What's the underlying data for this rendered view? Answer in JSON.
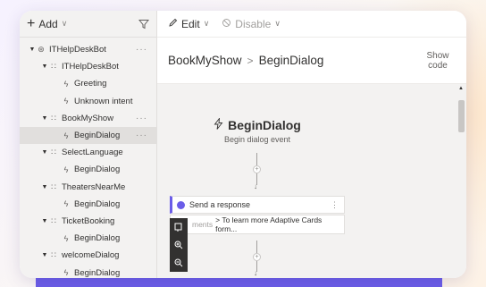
{
  "left_toolbar": {
    "add_label": "Add"
  },
  "tree": [
    {
      "label": "ITHelpDeskBot",
      "level": 0,
      "icon": "bot",
      "caret": true,
      "more": true,
      "selected": false
    },
    {
      "label": "ITHelpDeskBot",
      "level": 1,
      "icon": "dialog",
      "caret": true,
      "more": false,
      "selected": false
    },
    {
      "label": "Greeting",
      "level": 2,
      "icon": "trigger",
      "caret": false,
      "more": false,
      "selected": false
    },
    {
      "label": "Unknown intent",
      "level": 2,
      "icon": "trigger",
      "caret": false,
      "more": false,
      "selected": false
    },
    {
      "label": "BookMyShow",
      "level": 1,
      "icon": "dialog",
      "caret": true,
      "more": true,
      "selected": false
    },
    {
      "label": "BeginDialog",
      "level": 2,
      "icon": "trigger",
      "caret": false,
      "more": true,
      "selected": true
    },
    {
      "label": "SelectLanguage",
      "level": 1,
      "icon": "dialog",
      "caret": true,
      "more": false,
      "selected": false
    },
    {
      "label": "BeginDialog",
      "level": 2,
      "icon": "trigger",
      "caret": false,
      "more": false,
      "selected": false
    },
    {
      "label": "TheatersNearMe",
      "level": 1,
      "icon": "dialog",
      "caret": true,
      "more": false,
      "selected": false
    },
    {
      "label": "BeginDialog",
      "level": 2,
      "icon": "trigger",
      "caret": false,
      "more": false,
      "selected": false
    },
    {
      "label": "TicketBooking",
      "level": 1,
      "icon": "dialog",
      "caret": true,
      "more": false,
      "selected": false
    },
    {
      "label": "BeginDialog",
      "level": 2,
      "icon": "trigger",
      "caret": false,
      "more": false,
      "selected": false
    },
    {
      "label": "welcomeDialog",
      "level": 1,
      "icon": "dialog",
      "caret": true,
      "more": false,
      "selected": false
    },
    {
      "label": "BeginDialog",
      "level": 2,
      "icon": "trigger",
      "caret": false,
      "more": false,
      "selected": false
    }
  ],
  "toolbar": {
    "edit_label": "Edit",
    "disable_label": "Disable"
  },
  "breadcrumb": {
    "parent": "BookMyShow",
    "separator": ">",
    "current": "BeginDialog"
  },
  "show_code": {
    "line1": "Show",
    "line2": "code"
  },
  "trigger_node": {
    "title": "BeginDialog",
    "subtitle": "Begin dialog event"
  },
  "action_card": {
    "title": "Send a response",
    "body_prefix": "ments",
    "body_text": "> To learn more Adaptive Cards form..."
  },
  "colors": {
    "accent": "#6b5de8",
    "brand_bar": "#6b5de8"
  }
}
